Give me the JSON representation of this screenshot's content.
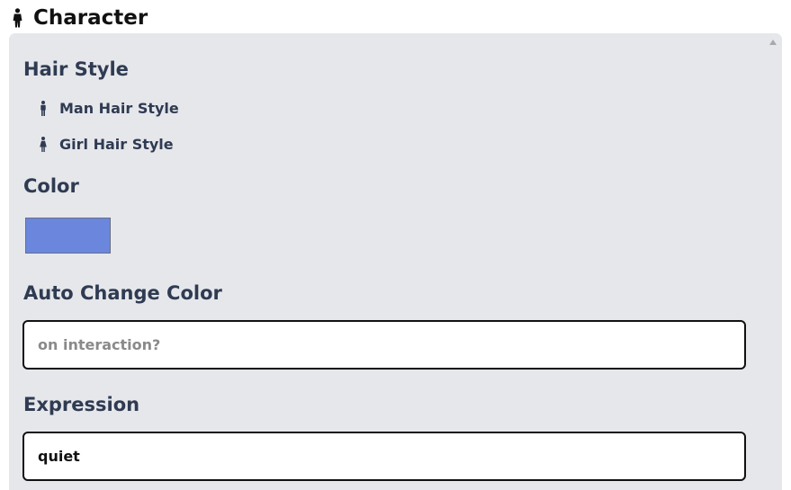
{
  "header": {
    "title": "Character",
    "icon": "person-icon"
  },
  "hair_style": {
    "title": "Hair Style",
    "options": [
      {
        "label": "Man Hair Style",
        "icon": "man-icon"
      },
      {
        "label": "Girl Hair Style",
        "icon": "woman-icon"
      }
    ]
  },
  "color": {
    "title": "Color",
    "swatch": "#6a87dd"
  },
  "auto_change": {
    "title": "Auto Change Color",
    "value": "",
    "placeholder": "on interaction?"
  },
  "expression": {
    "title": "Expression",
    "value": "quiet"
  },
  "colors": {
    "panel_bg": "#e6e7eb",
    "heading": "#2f3b52",
    "title_text": "#111111"
  }
}
